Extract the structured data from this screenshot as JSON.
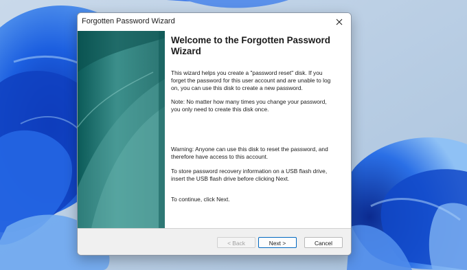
{
  "wizard": {
    "title": "Forgotten Password Wizard",
    "heading": "Welcome to the Forgotten Password Wizard",
    "paragraphs": [
      "This wizard helps you create a \"password reset\" disk. If you forget the password for this user account and are unable to log on, you can use this disk to create a new password.",
      "Note: No matter how many times you change your password, you only need to create this disk once.",
      "Warning: Anyone can use this disk to reset the password, and therefore have access to this account.",
      "To store password recovery information on a USB flash drive, insert the USB flash drive before clicking Next.",
      "To continue, click Next."
    ],
    "buttons": {
      "back": "< Back",
      "next": "Next >",
      "cancel": "Cancel"
    },
    "close_icon": "close-icon"
  },
  "colors": {
    "wallpaper_accent": "#1558d6",
    "side_panel": "#2b7572",
    "next_border": "#0067c0"
  }
}
